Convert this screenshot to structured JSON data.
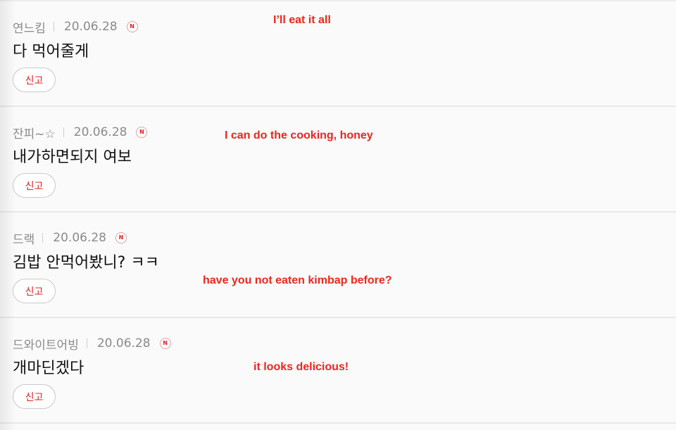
{
  "comments": [
    {
      "author": "연느킴",
      "date": "20.06.28",
      "new_badge": "N",
      "text": "다 먹어줄게",
      "report_label": "신고",
      "translation": "I’ll eat it all"
    },
    {
      "author": "잔피~☆",
      "date": "20.06.28",
      "new_badge": "N",
      "text": "내가하면되지 여보",
      "report_label": "신고",
      "translation": "I can do the cooking, honey"
    },
    {
      "author": "드랙",
      "date": "20.06.28",
      "new_badge": "N",
      "text": "김밥 안먹어봤니? ㅋㅋ",
      "report_label": "신고",
      "translation": "have you not eaten kimbap before?"
    },
    {
      "author": "드와이트어빙",
      "date": "20.06.28",
      "new_badge": "N",
      "text": "개마딘겠다",
      "report_label": "신고",
      "translation": "it looks delicious!"
    }
  ],
  "colors": {
    "accent": "#e0201c",
    "annotation": "#e8281c",
    "meta_text": "#8a8a8a",
    "background": "#fafafa"
  }
}
